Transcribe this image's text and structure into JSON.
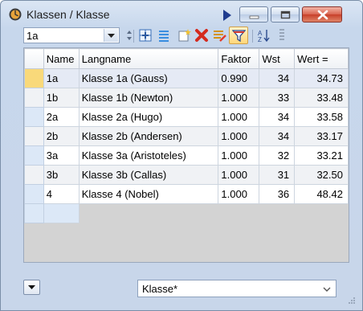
{
  "window": {
    "title": "Klassen / Klasse"
  },
  "toolbar": {
    "selected_class": "1a",
    "icons": [
      "stepper-icon",
      "grid-add-icon",
      "list-icon",
      "new-record-icon",
      "delete-icon",
      "edit-list-icon",
      "filter-icon",
      "sort-az-icon",
      "columns-icon"
    ]
  },
  "table": {
    "columns": [
      "Name",
      "Langname",
      "Faktor",
      "Wst",
      "Wert ="
    ],
    "rows": [
      {
        "name": "1a",
        "langname": "Klasse 1a (Gauss)",
        "faktor": "0.990",
        "wst": "34",
        "wert": "34.73"
      },
      {
        "name": "1b",
        "langname": "Klasse 1b (Newton)",
        "faktor": "1.000",
        "wst": "33",
        "wert": "33.48"
      },
      {
        "name": "2a",
        "langname": "Klasse 2a (Hugo)",
        "faktor": "1.000",
        "wst": "34",
        "wert": "33.58"
      },
      {
        "name": "2b",
        "langname": "Klasse 2b (Andersen)",
        "faktor": "1.000",
        "wst": "34",
        "wert": "33.17"
      },
      {
        "name": "3a",
        "langname": "Klasse 3a (Aristoteles)",
        "faktor": "1.000",
        "wst": "32",
        "wert": "33.21"
      },
      {
        "name": "3b",
        "langname": "Klasse 3b (Callas)",
        "faktor": "1.000",
        "wst": "31",
        "wert": "32.50"
      },
      {
        "name": "4",
        "langname": "Klasse 4 (Nobel)",
        "faktor": "1.000",
        "wst": "36",
        "wert": "48.42"
      }
    ]
  },
  "footer": {
    "view": "Klasse*"
  },
  "colors": {
    "title_bar": "#c7d7ec",
    "current_row_indicator": "#f9d97a",
    "close_button": "#c7402a"
  }
}
